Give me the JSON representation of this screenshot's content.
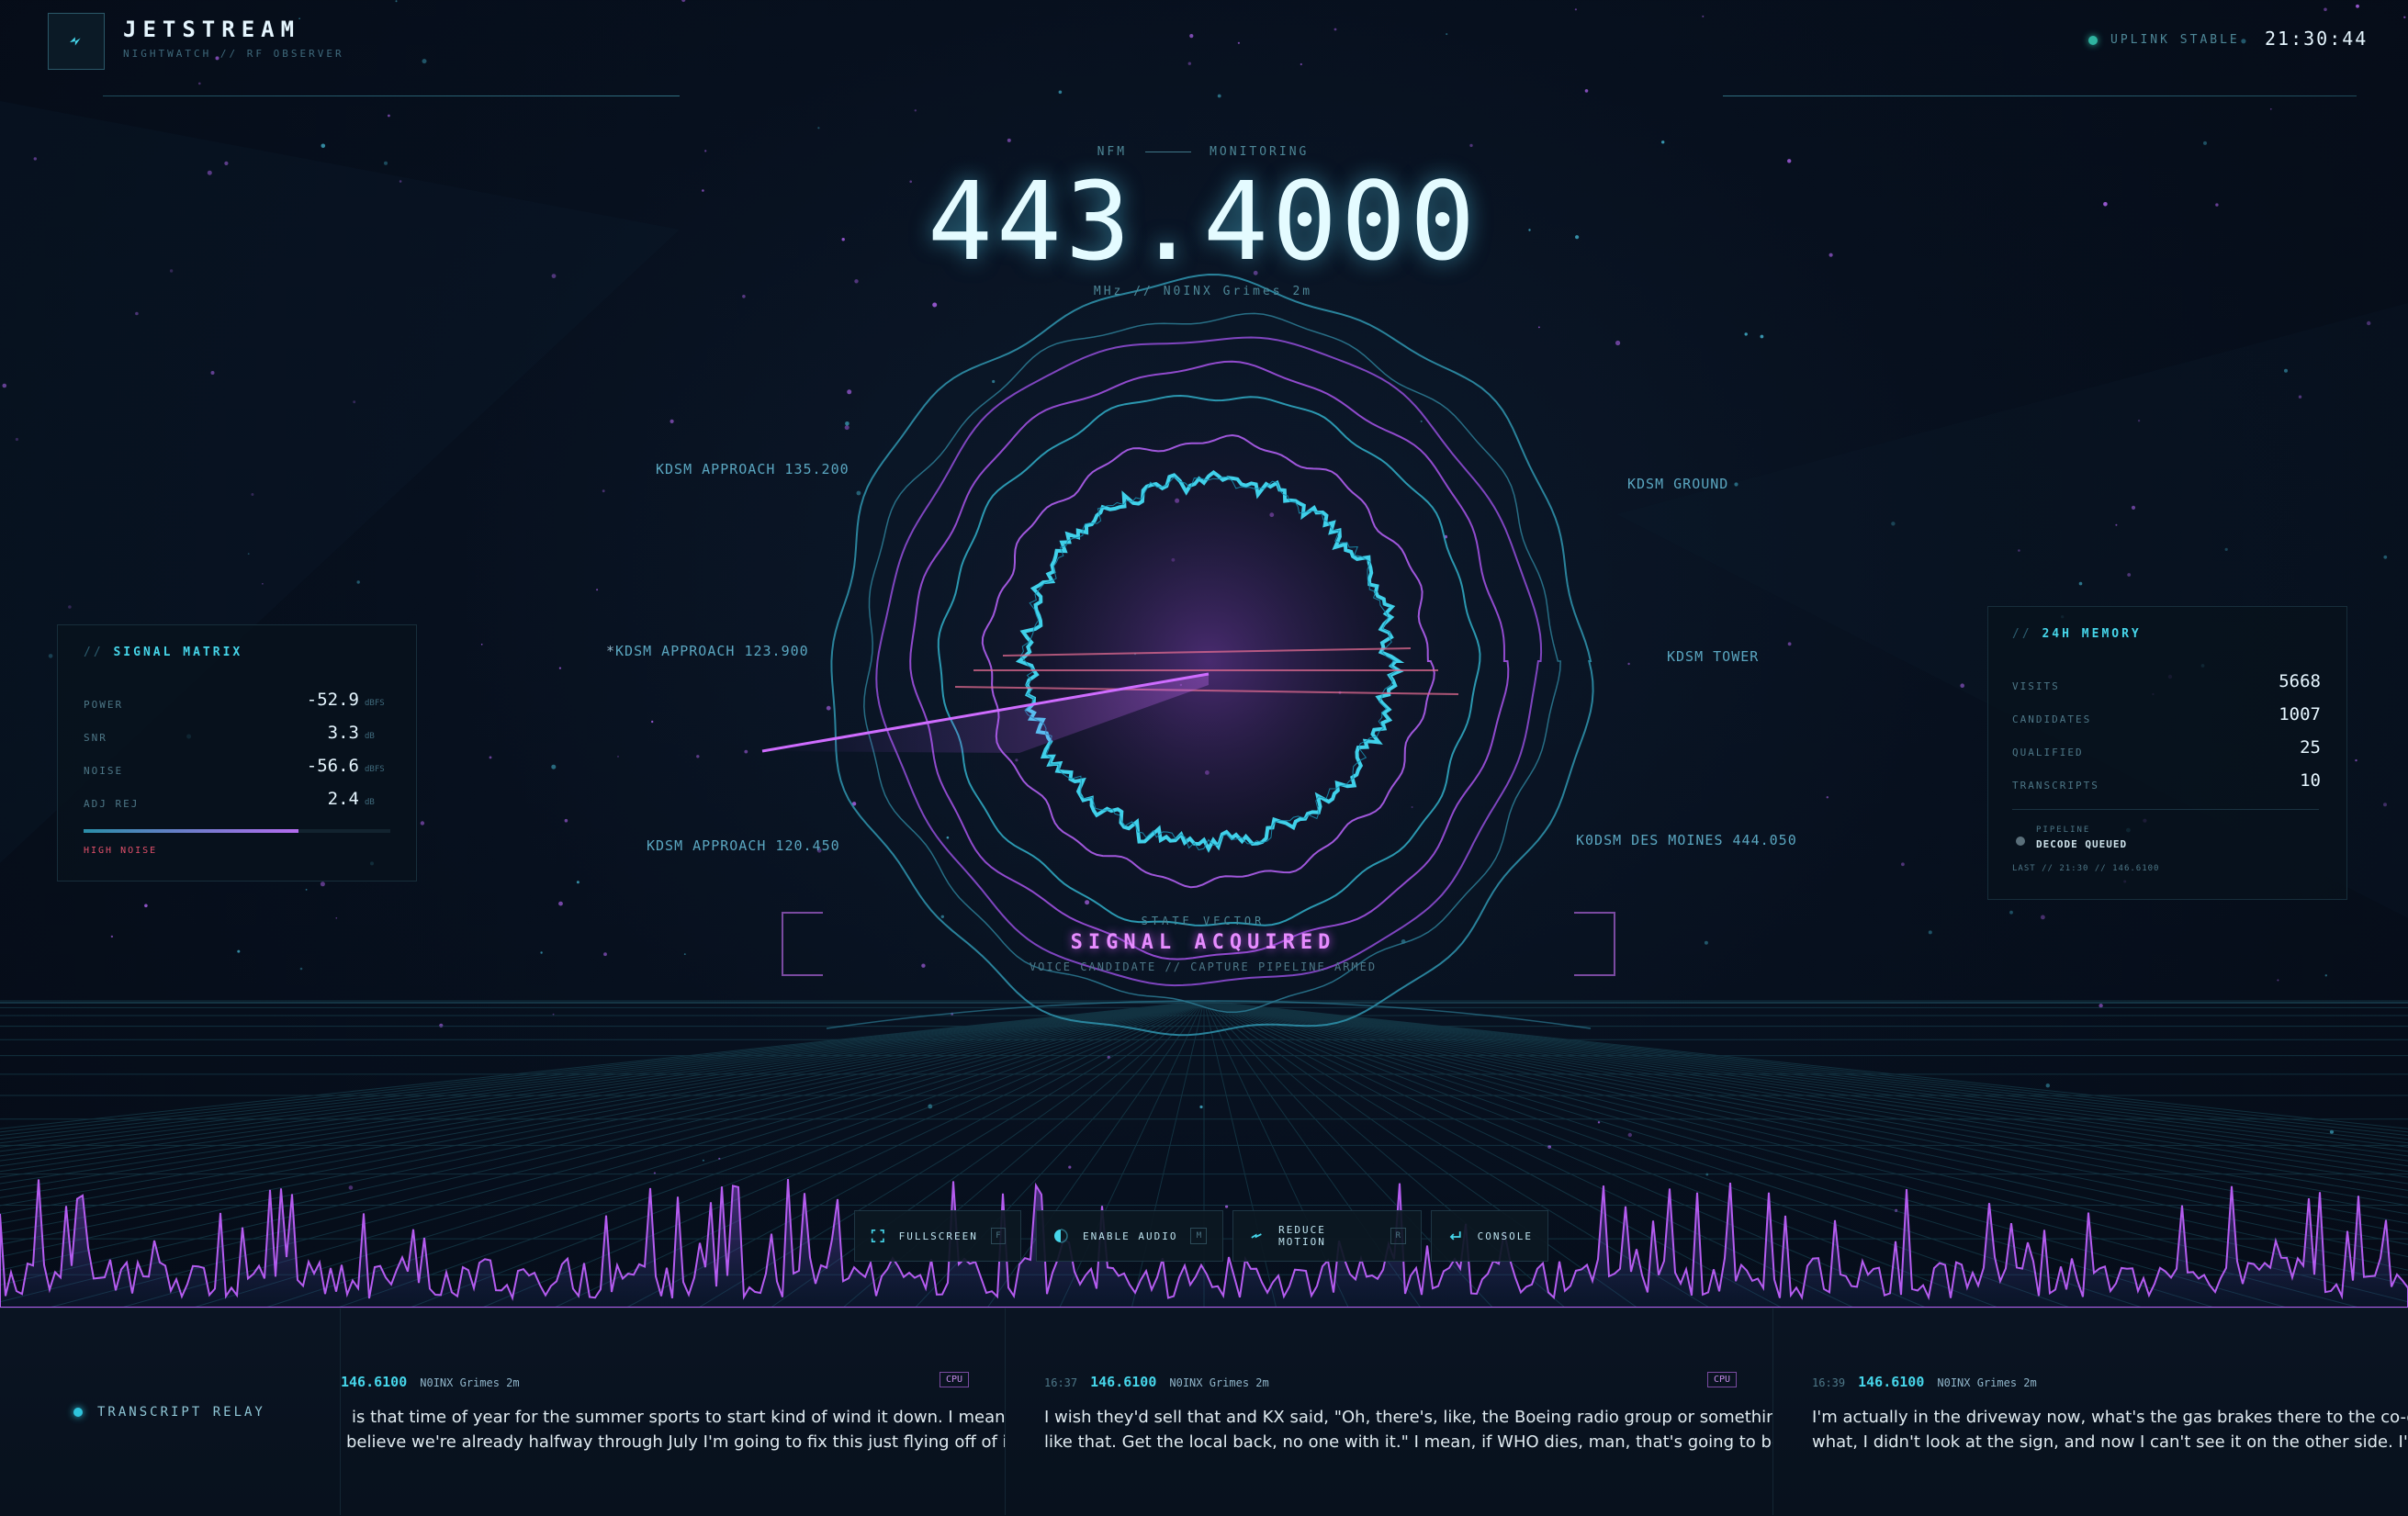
{
  "header": {
    "title": "JETSTREAM",
    "subtitle": "NIGHTWATCH // RF OBSERVER",
    "uplink": "UPLINK STABLE",
    "clock": "21:30:44"
  },
  "tuner": {
    "mode": "NFM",
    "status": "MONITORING",
    "frequency": "443.4000",
    "subtitle": "MHz // N0INX Grimes 2m"
  },
  "ring_labels": [
    "KDSM APPROACH 135.200",
    "KDSM APPROACH 123.900",
    "KDSM APPROACH 120.450",
    "KDSM GROUND",
    "KDSM TOWER",
    "K0DSM DES MOINES 444.050"
  ],
  "state": {
    "label": "STATE VECTOR",
    "value": "SIGNAL ACQUIRED",
    "detail": "VOICE CANDIDATE // CAPTURE PIPELINE ARMED"
  },
  "signal_matrix": {
    "prefix": "//",
    "title": "SIGNAL MATRIX",
    "rows": [
      {
        "label": "POWER",
        "value": "-52.9",
        "unit": "dBFS"
      },
      {
        "label": "SNR",
        "value": "3.3",
        "unit": "dB"
      },
      {
        "label": "NOISE",
        "value": "-56.6",
        "unit": "dBFS"
      },
      {
        "label": "ADJ REJ",
        "value": "2.4",
        "unit": "dB"
      }
    ],
    "meter_level": 0.7,
    "warning": "HIGH NOISE"
  },
  "memory": {
    "prefix": "//",
    "title": "24H MEMORY",
    "rows": [
      {
        "label": "VISITS",
        "value": "5668"
      },
      {
        "label": "CANDIDATES",
        "value": "1007"
      },
      {
        "label": "QUALIFIED",
        "value": "25"
      },
      {
        "label": "TRANSCRIPTS",
        "value": "10"
      }
    ],
    "pipeline_label": "PIPELINE",
    "pipeline_status": "DECODE QUEUED",
    "last": "LAST // 21:30 // 146.6100"
  },
  "controls": [
    {
      "label": "FULLSCREEN",
      "key": "F",
      "icon": "fullscreen-icon"
    },
    {
      "label": "ENABLE AUDIO",
      "key": "M",
      "icon": "audio-icon"
    },
    {
      "label": "REDUCE MOTION",
      "key": "R",
      "icon": "motion-icon"
    },
    {
      "label": "CONSOLE",
      "key": "",
      "icon": "return-icon"
    }
  ],
  "transcripts": {
    "label": "TRANSCRIPT RELAY",
    "items": [
      {
        "time": "",
        "freq": "146.6100",
        "source": "N0INX Grimes 2m",
        "badge": "CPU",
        "line1": "is that time of year for the summer sports to start kind of wind it down. I mean if",
        "line2": "believe we're already halfway through July I'm going to fix this just flying off of it...."
      },
      {
        "time": "16:37",
        "freq": "146.6100",
        "source": "N0INX Grimes 2m",
        "badge": "CPU",
        "line1": "I wish they'd sell that and KX said, \"Oh, there's, like, the Boeing radio group or something",
        "line2": "like that. Get the local back, no one with it.\" I mean, if WHO dies, man, that's going to be a..."
      },
      {
        "time": "16:39",
        "freq": "146.6100",
        "source": "N0INX Grimes 2m",
        "badge": "",
        "line1": "I'm actually in the driveway now, what's the gas brakes there to the co-op? You",
        "line2": "what, I didn't look at the sign, and now I can't see it on the other side. I'm just c"
      }
    ]
  },
  "colors": {
    "cyan": "#46d6ea",
    "magenta": "#b35ee8",
    "warning": "#e0506a",
    "background": "#060d18"
  }
}
